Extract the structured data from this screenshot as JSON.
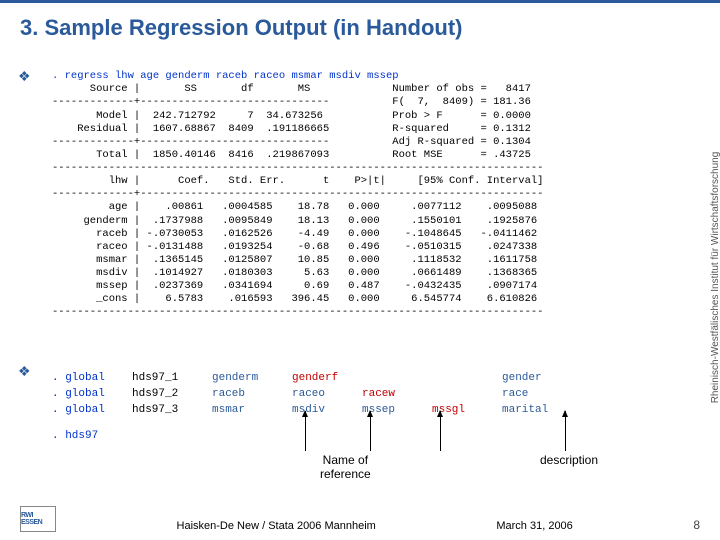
{
  "title_main": "3. Sample Regression Output ",
  "title_sub": "(in Handout)",
  "cmdline": ". regress lhw age genderm raceb raceo msmar msdiv mssep",
  "stats_labels": {
    "nobs": "Number of obs =",
    "f": "F(  7,  8409) =",
    "probf": "Prob > F      =",
    "r2": "R-squared     =",
    "adjr2": "Adj R-squared =",
    "rmse": "Root MSE      ="
  },
  "stats_vals": {
    "nobs": "   8417",
    "f": " 181.36",
    "probf": " 0.0000",
    "r2": " 0.1312",
    "adjr2": " 0.1304",
    "rmse": " .43725"
  },
  "anova": {
    "header": "      Source |       SS       df       MS   ",
    "model": "       Model |  242.712792     7  34.673256 ",
    "resid": "    Residual |  1607.68867  8409  .191186665",
    "total": "       Total |  1850.40146  8416  .219867093"
  },
  "coef_header": "         lhw |      Coef.   Std. Err.      t    P>|t|     [95% Conf. Interval]",
  "coefs": [
    "         age |    .00861   .0004585    18.78   0.000     .0077112    .0095088",
    "     genderm |  .1737988   .0095849    18.13   0.000     .1550101    .1925876",
    "       raceb | -.0730053   .0162526    -4.49   0.000    -.1048645   -.0411462",
    "       raceo | -.0131488   .0193254    -0.68   0.496    -.0510315    .0247338",
    "       msmar |  .1365145   .0125807    10.85   0.000     .1118532    .1611758",
    "       msdiv |  .1014927   .0180303     5.63   0.000     .0661489    .1368365",
    "       mssep |  .0237369   .0341694     0.69   0.487    -.0432435    .0907174",
    "       _cons |    6.5783    .016593   396.45   0.000     6.545774    6.610826"
  ],
  "globals": [
    {
      "cmd": ". global",
      "name": "hds97_1",
      "c3": "genderm",
      "c4": "genderf",
      "c5": "",
      "c6": "",
      "c7": "gender"
    },
    {
      "cmd": ". global",
      "name": "hds97_2",
      "c3": "raceb",
      "c4": "raceo",
      "c5": "racew",
      "c6": "",
      "c7": "race"
    },
    {
      "cmd": ". global",
      "name": "hds97_3",
      "c3": "msmar",
      "c4": "msdiv",
      "c5": "mssep",
      "c6": "mssgl",
      "c7": "marital"
    }
  ],
  "hds_cmd": ". hds97",
  "ann_nameref": "Name of\nreference",
  "ann_desc": "description",
  "sidebar": "Rheinisch-Westfälisches Institut für Wirtschaftsforschung",
  "footer_author": "Haisken-De New / Stata 2006 Mannheim",
  "footer_date": "March 31, 2006",
  "footer_page": "8",
  "logo": "RWI ESSEN"
}
